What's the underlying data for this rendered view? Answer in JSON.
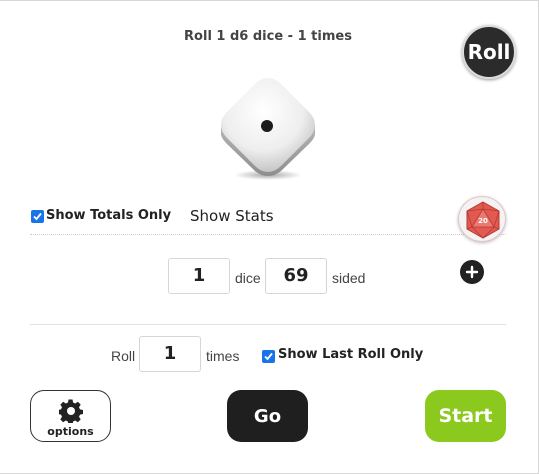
{
  "header": {
    "title": "Roll 1 d6 dice - 1 times",
    "roll_label": "Roll"
  },
  "die": {
    "sides": 6,
    "face_shown": 1
  },
  "totals": {
    "show_totals_only_label": "Show Totals Only",
    "show_totals_only_checked": true,
    "show_stats_label": "Show Stats",
    "d20_icon_text": "20"
  },
  "dice_config": {
    "count": "1",
    "dice_label": "dice",
    "sides": "69",
    "sided_label": "sided"
  },
  "roll_config": {
    "roll_label": "Roll",
    "times": "1",
    "times_label": "times",
    "show_last_roll_only_label": "Show Last Roll Only",
    "show_last_roll_only_checked": true
  },
  "actions": {
    "options_label": "options",
    "go_label": "Go",
    "start_label": "Start"
  },
  "colors": {
    "accent_blue": "#1a73e8",
    "start_green": "#8cc91e",
    "dark_button": "#1f1f1f",
    "d20_red": "#e05a52"
  }
}
